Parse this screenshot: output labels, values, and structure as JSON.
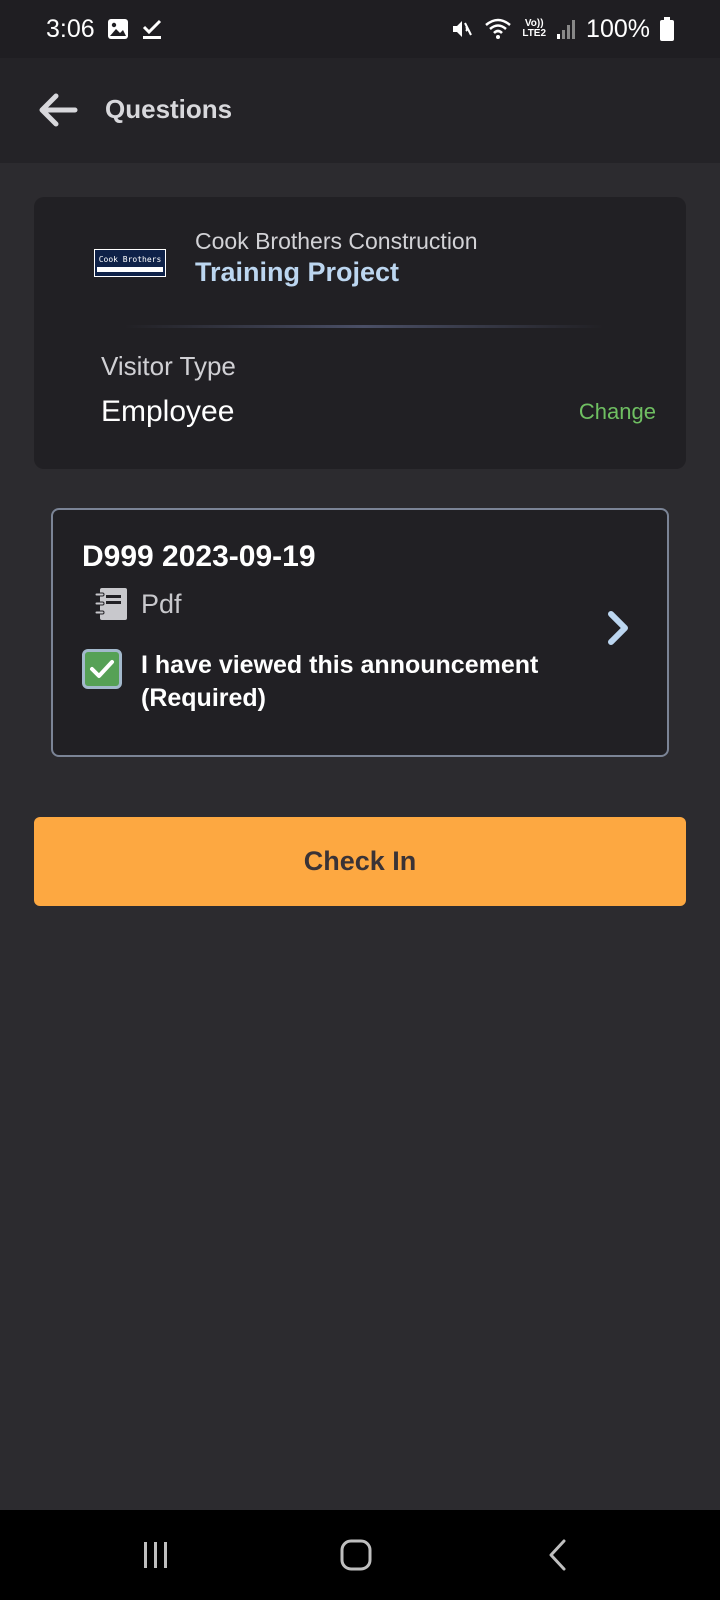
{
  "status_bar": {
    "time": "3:06",
    "battery_percent": "100%",
    "network_label_top": "Vo))",
    "network_label_bottom": "LTE2"
  },
  "app_bar": {
    "title": "Questions"
  },
  "project_card": {
    "company": "Cook Brothers Construction",
    "project": "Training Project",
    "logo_text": "Cook Brothers",
    "visitor_type_label": "Visitor Type",
    "visitor_type_value": "Employee",
    "change_label": "Change"
  },
  "announcement": {
    "title": "D999 2023-09-19",
    "doc_type": "Pdf",
    "checkbox_checked": true,
    "confirm_text": "I have viewed this announcement (Required)"
  },
  "actions": {
    "check_in_label": "Check In"
  },
  "colors": {
    "background": "#2c2b2f",
    "card": "#212024",
    "accent_orange": "#fda841",
    "project_blue": "#bcd6f0",
    "change_green": "#6fbf62",
    "checkbox_green": "#56a156"
  },
  "icons": {
    "back": "arrow-left-icon",
    "document": "notebook-icon",
    "chevron": "chevron-right-icon",
    "checkbox": "check-icon"
  }
}
